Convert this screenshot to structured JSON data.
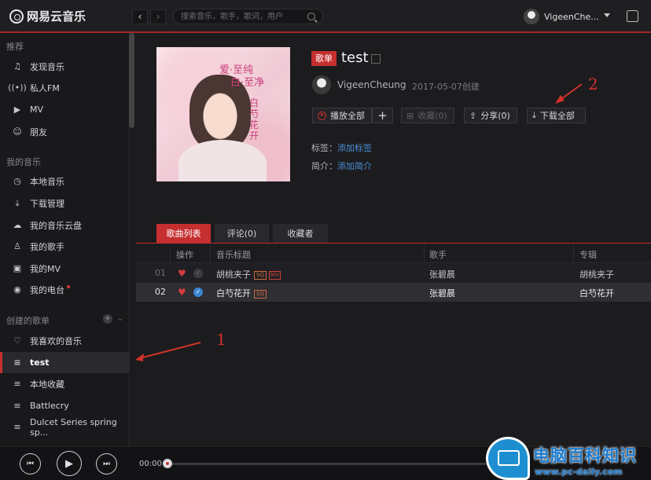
{
  "app": {
    "logo_text": "网易云音乐"
  },
  "topbar": {
    "back": "‹",
    "forward": "›",
    "search_placeholder": "搜索音乐，歌手，歌词，用户",
    "username": "VigeenChe...",
    "accent": "#c62f2f"
  },
  "sidebar": {
    "section_recommend": "推荐",
    "recommend_items": [
      {
        "label": "发现音乐",
        "icon": "music-note-icon"
      },
      {
        "label": "私人FM",
        "icon": "radio-icon"
      },
      {
        "label": "MV",
        "icon": "video-icon"
      },
      {
        "label": "朋友",
        "icon": "friends-icon"
      }
    ],
    "section_mymusic": "我的音乐",
    "mymusic_items": [
      {
        "label": "本地音乐",
        "icon": "local-music-icon"
      },
      {
        "label": "下载管理",
        "icon": "download-icon"
      },
      {
        "label": "我的音乐云盘",
        "icon": "cloud-icon"
      },
      {
        "label": "我的歌手",
        "icon": "singer-icon"
      },
      {
        "label": "我的MV",
        "icon": "my-mv-icon"
      },
      {
        "label": "我的电台",
        "icon": "dj-radio-icon"
      }
    ],
    "section_created": "创建的歌单",
    "playlists": [
      {
        "label": "我喜欢的音乐",
        "icon": "heart-icon"
      },
      {
        "label": "test",
        "icon": "playlist-icon",
        "active": true
      },
      {
        "label": "本地收藏",
        "icon": "playlist-icon"
      },
      {
        "label": "Battlecry",
        "icon": "playlist-icon"
      },
      {
        "label": "Dulcet Series spring sp...",
        "icon": "playlist-icon"
      }
    ]
  },
  "playlist": {
    "badge": "歌单",
    "title": "test",
    "creator": "VigeenCheung",
    "created": "2017-05-07创建",
    "cover": {
      "title_line1": "爱·至纯",
      "title_line2": "白·至净",
      "vertical_text": "白芍花开"
    },
    "buttons": {
      "play_all": "播放全部",
      "add": "+",
      "collect": "收藏(0)",
      "share": "分享(0)",
      "download_all": "下载全部"
    },
    "tags_label": "标签：",
    "tags_link": "添加标签",
    "intro_label": "简介：",
    "intro_link": "添加简介"
  },
  "tabs": [
    "歌曲列表",
    "评论(0)",
    "收藏者"
  ],
  "table": {
    "headers": {
      "ops": "操作",
      "title": "音乐标题",
      "artist": "歌手",
      "album": "专辑"
    },
    "rows": [
      {
        "index": "01",
        "title": "胡桃夹子",
        "quality": "SQ",
        "has_mv": true,
        "mv": "MV",
        "artist": "张碧晨",
        "album": "胡桃夹子",
        "downloaded": false
      },
      {
        "index": "02",
        "title": "白芍花开",
        "quality": "SQ",
        "has_mv": false,
        "artist": "张碧晨",
        "album": "白芍花开",
        "downloaded": true
      }
    ]
  },
  "player": {
    "time": "00:00",
    "progress": 0
  },
  "annotations": {
    "one": "1",
    "two": "2"
  },
  "watermark": {
    "text": "电脑百科知识",
    "url": "www.pc-daily.com"
  }
}
